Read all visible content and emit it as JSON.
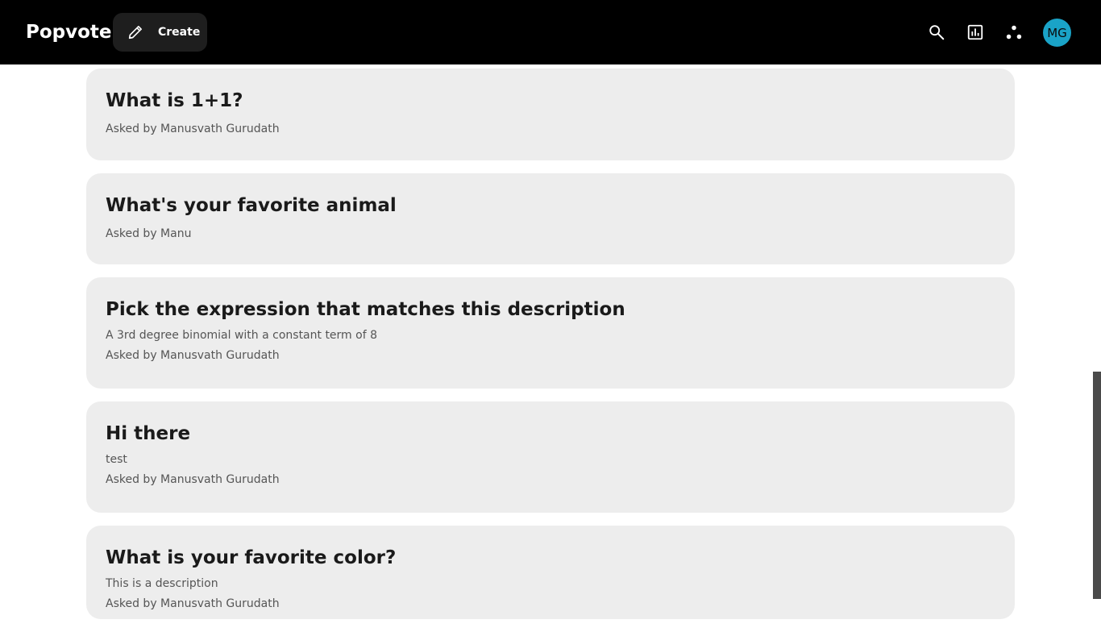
{
  "app": {
    "title": "Popvote"
  },
  "header": {
    "create_label": "Create",
    "icons": [
      "search-icon",
      "stats-icon",
      "network-icon"
    ],
    "avatar_initials": "MG",
    "avatar_color": "#1aa3c7"
  },
  "questions": [
    {
      "title": "What is 1+1?",
      "description": "",
      "asked_by": "Asked by Manusvath Gurudath"
    },
    {
      "title": "What's your favorite animal",
      "description": "",
      "asked_by": "Asked by Manu"
    },
    {
      "title": "Pick the expression that matches this description",
      "description": "A 3rd degree binomial with a constant term of 8",
      "asked_by": "Asked by Manusvath Gurudath"
    },
    {
      "title": "Hi there",
      "description": "test",
      "asked_by": "Asked by Manusvath Gurudath"
    },
    {
      "title": "What is your favorite color?",
      "description": "This is a description",
      "asked_by": "Asked by Manusvath Gurudath"
    }
  ]
}
